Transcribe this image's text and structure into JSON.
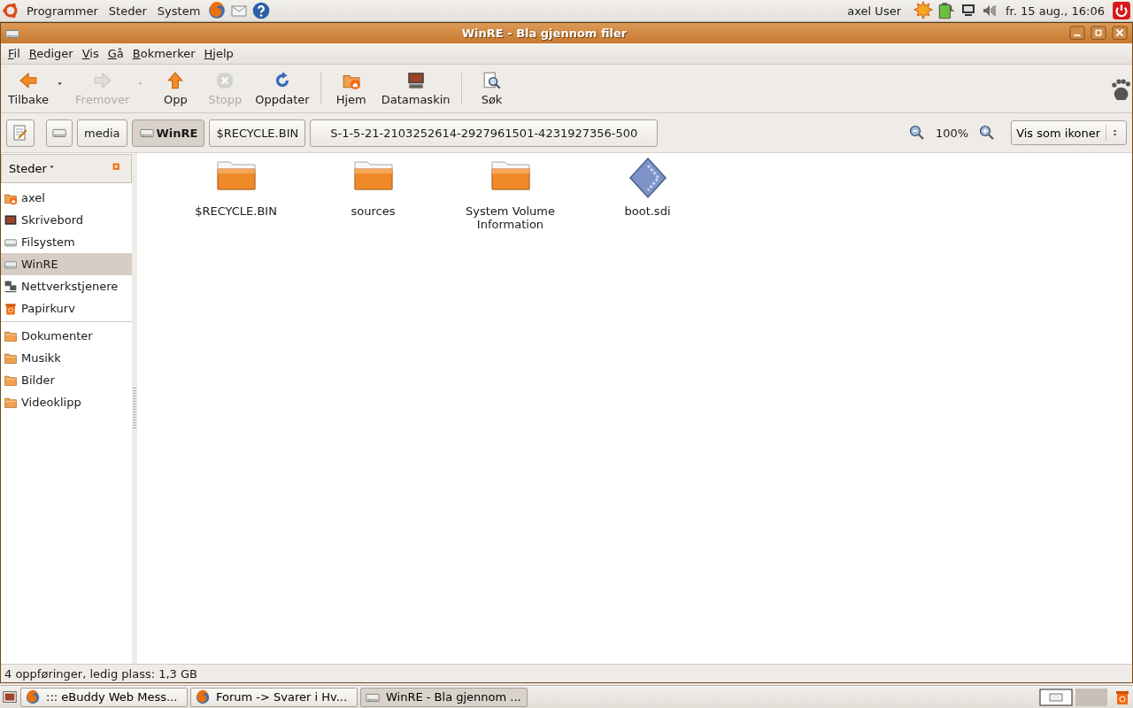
{
  "top_panel": {
    "menus": [
      "Programmer",
      "Steder",
      "System"
    ],
    "user": "axel User",
    "clock": "fr. 15 aug., 16:06"
  },
  "window": {
    "title": "WinRE - Bla gjennom filer"
  },
  "menu_bar": [
    "Fil",
    "Rediger",
    "Vis",
    "Gå",
    "Bokmerker",
    "Hjelp"
  ],
  "toolbar": [
    {
      "kind": "back",
      "label": "Tilbake",
      "disabled": false,
      "dropdown": true
    },
    {
      "kind": "forward",
      "label": "Fremover",
      "disabled": true,
      "dropdown": true
    },
    {
      "kind": "up",
      "label": "Opp",
      "disabled": false,
      "dropdown": false
    },
    {
      "kind": "stop",
      "label": "Stopp",
      "disabled": true,
      "dropdown": false
    },
    {
      "kind": "reload",
      "label": "Oppdater",
      "disabled": false,
      "dropdown": false
    },
    {
      "kind": "separator"
    },
    {
      "kind": "home",
      "label": "Hjem",
      "disabled": false,
      "dropdown": false
    },
    {
      "kind": "computer",
      "label": "Datamaskin",
      "disabled": false,
      "dropdown": false
    },
    {
      "kind": "separator"
    },
    {
      "kind": "search",
      "label": "Søk",
      "disabled": false,
      "dropdown": false
    }
  ],
  "path_bar": {
    "crumbs": [
      {
        "label": "media",
        "selected": false,
        "drive": false
      },
      {
        "label": "WinRE",
        "selected": true,
        "drive": true
      },
      {
        "label": "$RECYCLE.BIN",
        "selected": false,
        "drive": false
      },
      {
        "label": "S-1-5-21-2103252614-2927961501-4231927356-500",
        "selected": false,
        "drive": false
      }
    ],
    "zoom": "100%",
    "view": "Vis som ikoner"
  },
  "sidebar": {
    "title": "Steder",
    "groups": [
      [
        {
          "label": "axel",
          "kind": "home",
          "selected": false
        },
        {
          "label": "Skrivebord",
          "kind": "desktop",
          "selected": false
        },
        {
          "label": "Filsystem",
          "kind": "drive",
          "selected": false
        },
        {
          "label": "WinRE",
          "kind": "drive",
          "selected": true
        },
        {
          "label": "Nettverkstjenere",
          "kind": "network",
          "selected": false
        },
        {
          "label": "Papirkurv",
          "kind": "trash",
          "selected": false
        }
      ],
      [
        {
          "label": "Dokumenter",
          "kind": "folder",
          "selected": false
        },
        {
          "label": "Musikk",
          "kind": "folder",
          "selected": false
        },
        {
          "label": "Bilder",
          "kind": "folder",
          "selected": false
        },
        {
          "label": "Videoklipp",
          "kind": "folder",
          "selected": false
        }
      ]
    ]
  },
  "files": [
    {
      "name": "$RECYCLE.BIN",
      "kind": "folder"
    },
    {
      "name": "sources",
      "kind": "folder"
    },
    {
      "name": "System Volume Information",
      "kind": "folder"
    },
    {
      "name": "boot.sdi",
      "kind": "file"
    }
  ],
  "status_bar": "4 oppføringer, ledig plass: 1,3 GB",
  "taskbar": [
    {
      "label": "::: eBuddy Web Mess...",
      "kind": "browser",
      "selected": false
    },
    {
      "label": "Forum -> Svarer i Hv...",
      "kind": "browser",
      "selected": false
    },
    {
      "label": "WinRE - Bla gjennom ...",
      "kind": "drive",
      "selected": true
    }
  ]
}
